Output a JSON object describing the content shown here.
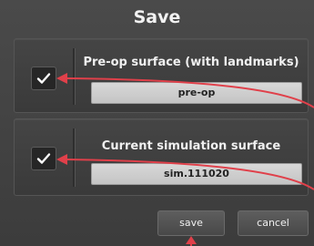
{
  "dialog": {
    "title": "Save",
    "options": [
      {
        "label": "Pre-op surface (with landmarks)",
        "value": "pre-op",
        "checked": true
      },
      {
        "label": "Current simulation surface",
        "value": "sim.111020",
        "checked": true
      }
    ],
    "buttons": {
      "save_label": "save",
      "cancel_label": "cancel"
    }
  },
  "colors": {
    "background": "#3c3c3c",
    "field": "#cfcfcf",
    "annotation_arrow": "#e0404a"
  },
  "icons": [
    "check-icon",
    "check-icon"
  ]
}
